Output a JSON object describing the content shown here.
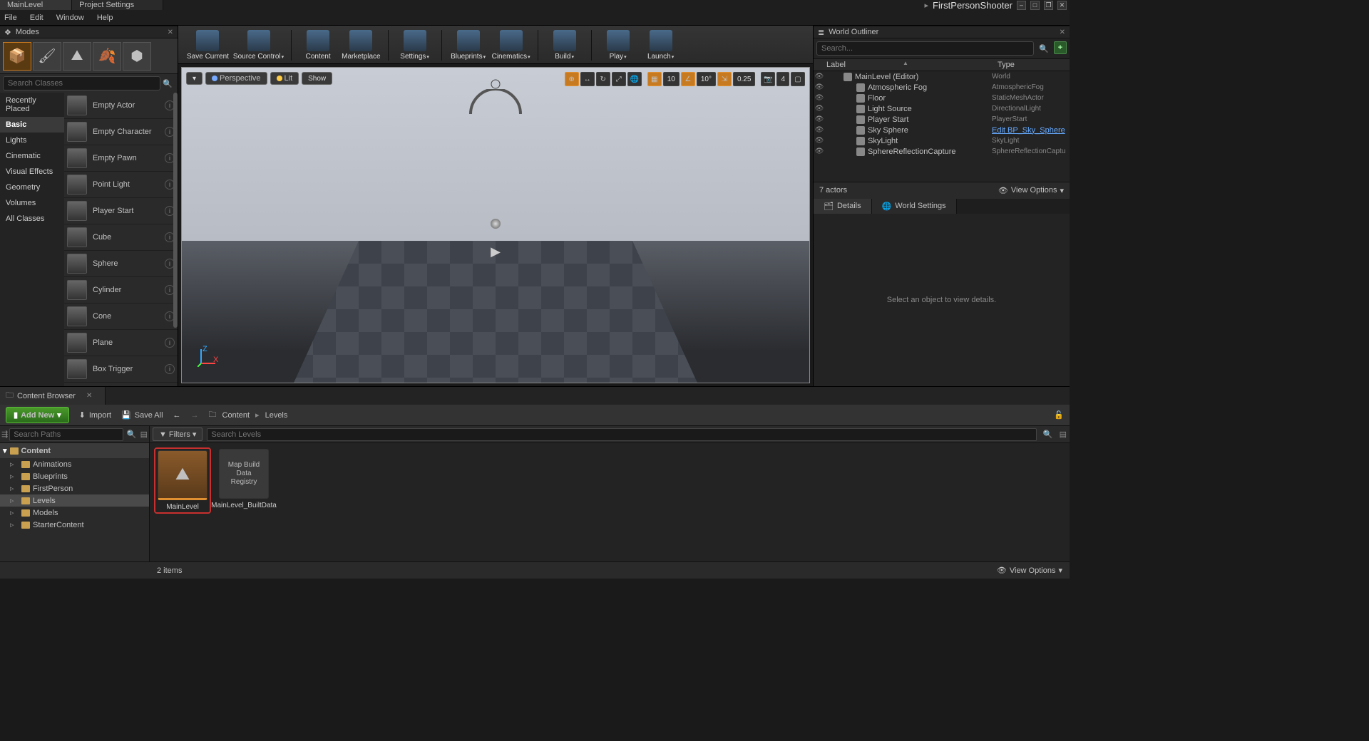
{
  "titlebar": {
    "tabs": [
      "MainLevel",
      "Project Settings"
    ],
    "project": "FirstPersonShooter"
  },
  "menu": [
    "File",
    "Edit",
    "Window",
    "Help"
  ],
  "modes": {
    "title": "Modes",
    "search_ph": "Search Classes",
    "categories": [
      "Recently Placed",
      "Basic",
      "Lights",
      "Cinematic",
      "Visual Effects",
      "Geometry",
      "Volumes",
      "All Classes"
    ],
    "active_cat": "Basic",
    "actors": [
      "Empty Actor",
      "Empty Character",
      "Empty Pawn",
      "Point Light",
      "Player Start",
      "Cube",
      "Sphere",
      "Cylinder",
      "Cone",
      "Plane",
      "Box Trigger"
    ]
  },
  "toolbar": [
    {
      "label": "Save Current",
      "dd": false
    },
    {
      "label": "Source Control",
      "dd": true
    },
    {
      "sep": true
    },
    {
      "label": "Content",
      "dd": false
    },
    {
      "label": "Marketplace",
      "dd": false
    },
    {
      "sep": true
    },
    {
      "label": "Settings",
      "dd": true
    },
    {
      "sep": true
    },
    {
      "label": "Blueprints",
      "dd": true
    },
    {
      "label": "Cinematics",
      "dd": true
    },
    {
      "sep": true
    },
    {
      "label": "Build",
      "dd": true
    },
    {
      "sep": true
    },
    {
      "label": "Play",
      "dd": true
    },
    {
      "label": "Launch",
      "dd": true
    }
  ],
  "viewport": {
    "left": [
      "Perspective",
      "Lit",
      "Show"
    ],
    "vals": {
      "grid": "10",
      "angle": "10°",
      "scale": "0.25",
      "cam": "4"
    }
  },
  "outliner": {
    "title": "World Outliner",
    "search_ph": "Search...",
    "cols": [
      "Label",
      "Type"
    ],
    "rows": [
      {
        "label": "MainLevel (Editor)",
        "type": "World",
        "indent": 1
      },
      {
        "label": "Atmospheric Fog",
        "type": "AtmosphericFog",
        "indent": 2
      },
      {
        "label": "Floor",
        "type": "StaticMeshActor",
        "indent": 2
      },
      {
        "label": "Light Source",
        "type": "DirectionalLight",
        "indent": 2
      },
      {
        "label": "Player Start",
        "type": "PlayerStart",
        "indent": 2
      },
      {
        "label": "Sky Sphere",
        "type": "Edit BP_Sky_Sphere",
        "indent": 2,
        "link": true
      },
      {
        "label": "SkyLight",
        "type": "SkyLight",
        "indent": 2
      },
      {
        "label": "SphereReflectionCapture",
        "type": "SphereReflectionCaptu",
        "indent": 2
      }
    ],
    "count": "7 actors",
    "view_options": "View Options"
  },
  "details": {
    "tabs": [
      "Details",
      "World Settings"
    ],
    "placeholder": "Select an object to view details."
  },
  "content_browser": {
    "title": "Content Browser",
    "add_new": "Add New",
    "import": "Import",
    "save_all": "Save All",
    "breadcrumb": [
      "Content",
      "Levels"
    ],
    "search_paths_ph": "Search Paths",
    "filters": "Filters",
    "search_levels_ph": "Search Levels",
    "tree_root": "Content",
    "tree": [
      "Animations",
      "Blueprints",
      "FirstPerson",
      "Levels",
      "Models",
      "StarterContent"
    ],
    "tree_sel": "Levels",
    "assets": [
      {
        "name": "MainLevel",
        "sel": true,
        "type": "level"
      },
      {
        "name": "MainLevel_BuiltData",
        "sub": "Map Build\nData Registry",
        "type": "data"
      }
    ],
    "count": "2 items",
    "view_options": "View Options"
  }
}
